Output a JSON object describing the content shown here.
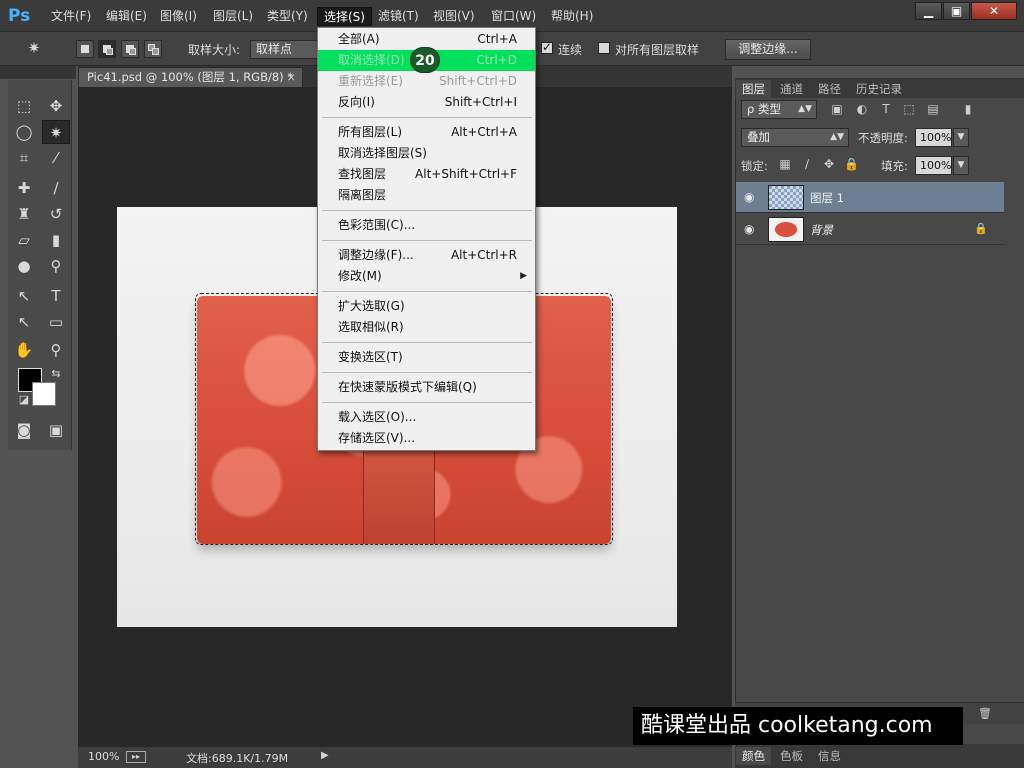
{
  "app": {
    "logo": "Ps",
    "menus": [
      "文件(F)",
      "编辑(E)",
      "图像(I)",
      "图层(L)",
      "类型(Y)",
      "选择(S)",
      "滤镜(T)",
      "视图(V)",
      "窗口(W)",
      "帮助(H)"
    ],
    "window_controls": {
      "minimize": "▁",
      "maximize": "▣",
      "close": "✕"
    }
  },
  "options": {
    "sample_size_label": "取样大小:",
    "sample_value": "取样点",
    "contiguous_label": "连续",
    "all_layers_label": "对所有图层取样",
    "refine_edge": "调整边缘..."
  },
  "document": {
    "tab_title": "Pic41.psd @ 100% (图层 1, RGB/8) *",
    "tab_close": "×",
    "zoom": "100%",
    "doc_info": "文档:689.1K/1.79M"
  },
  "select_menu": {
    "items": [
      {
        "label": "全部(A)",
        "shortcut": "Ctrl+A"
      },
      {
        "label": "取消选择(D)",
        "shortcut": "Ctrl+D"
      },
      {
        "label": "重新选择(E)",
        "shortcut": "Shift+Ctrl+D"
      },
      {
        "label": "反向(I)",
        "shortcut": "Shift+Ctrl+I"
      },
      {
        "label": "所有图层(L)",
        "shortcut": "Alt+Ctrl+A"
      },
      {
        "label": "取消选择图层(S)",
        "shortcut": ""
      },
      {
        "label": "查找图层",
        "shortcut": "Alt+Shift+Ctrl+F"
      },
      {
        "label": "隔离图层",
        "shortcut": ""
      },
      {
        "label": "色彩范围(C)...",
        "shortcut": ""
      },
      {
        "label": "调整边缘(F)...",
        "shortcut": "Alt+Ctrl+R"
      },
      {
        "label": "修改(M)",
        "shortcut": ""
      },
      {
        "label": "扩大选取(G)",
        "shortcut": ""
      },
      {
        "label": "选取相似(R)",
        "shortcut": ""
      },
      {
        "label": "变换选区(T)",
        "shortcut": ""
      },
      {
        "label": "在快速蒙版模式下编辑(Q)",
        "shortcut": ""
      },
      {
        "label": "载入选区(O)...",
        "shortcut": ""
      },
      {
        "label": "存储选区(V)...",
        "shortcut": ""
      }
    ],
    "step_badge": "20"
  },
  "layers_panel": {
    "tabs": [
      "图层",
      "通道",
      "路径",
      "历史记录"
    ],
    "filter_kind": "ρ 类型",
    "blend_mode": "叠加",
    "opacity_label": "不透明度:",
    "opacity_value": "100%",
    "lock_label": "锁定:",
    "fill_label": "填充:",
    "fill_value": "100%",
    "layers": [
      {
        "name": "图层 1"
      },
      {
        "name": "背景"
      }
    ]
  },
  "bottom_panel": {
    "tabs": [
      "颜色",
      "色板",
      "信息"
    ]
  },
  "watermark": "酷课堂出品 coolketang.com",
  "colors": {
    "highlight": "#00e05c",
    "selected_layer": "#6f7f93",
    "badge": "#1a5a2b"
  }
}
